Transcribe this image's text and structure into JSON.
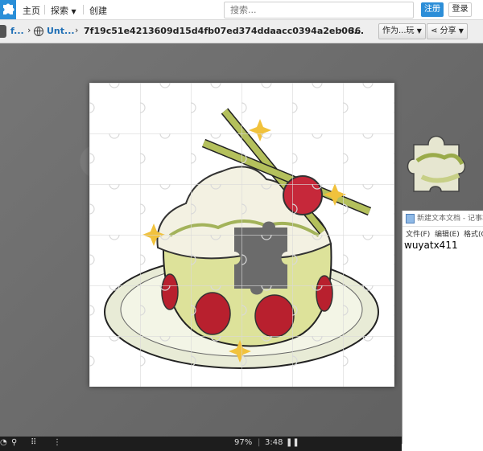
{
  "nav": {
    "home": "主页",
    "explore": "探索",
    "create": "创建",
    "search_placeholder": "搜索...",
    "register": "注册",
    "login": "登录"
  },
  "breadcrumb": {
    "user": "f...",
    "folder": "Unt...",
    "puzzle_id": "7f19c51e4213609d15d4fb07ed374ddaacc0394a2eb06...",
    "count": "36",
    "play_as": "作为...玩",
    "share": "分享"
  },
  "notepad": {
    "title": "新建文本文档 - 记事本",
    "menu": [
      "文件(F)",
      "编辑(E)",
      "格式(O)"
    ],
    "text": "wuyatx411"
  },
  "status": {
    "zoom": "97%",
    "time": "3:48"
  },
  "colors": {
    "accent": "#2c8ed8",
    "workspace": "#6b6b6b",
    "bottombar": "#1d1d1d"
  }
}
